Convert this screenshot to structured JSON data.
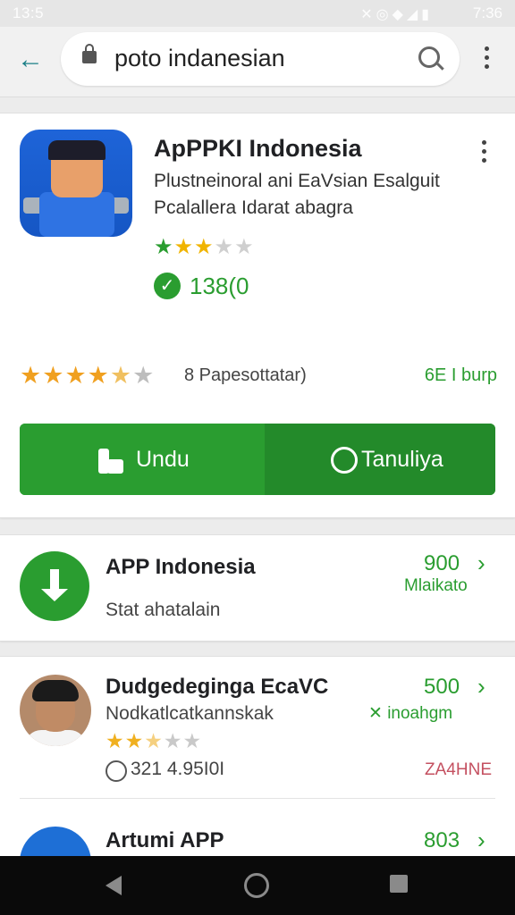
{
  "status_bar": {
    "time_left": "13:5",
    "icons": [
      "mute-icon",
      "alarm-icon",
      "wifi-icon",
      "signal-icon",
      "battery-icon"
    ],
    "time_right": "7:36"
  },
  "search": {
    "query": "poto indanesian"
  },
  "app": {
    "title": "ApPPKI Indonesia",
    "subtitle_line1": "Plustneinoral ani EaVsian Esalguit",
    "subtitle_line2": "Pcalallera Idarat abagra",
    "small_rating_stars": 3,
    "badge_count": "138(0",
    "rating_stars": 5,
    "rating_text": "8 Papesottatar)",
    "size_text": "6E I burp",
    "download_label": "Undu",
    "secondary_label": "Tanuliya"
  },
  "list": [
    {
      "title": "APP Indonesia",
      "subtitle": "Stat ahatalain",
      "number": "900",
      "green_label": "Mlaikato"
    },
    {
      "title": "Dudgedeginga EcaVC",
      "subtitle": "Nodkatlcatkannskak",
      "number": "500",
      "green_label": "inoahgm",
      "stars": 3,
      "info_text": "321 4.95I0I",
      "red_tag": "ZA4HNE"
    },
    {
      "title": "Artumi  APP",
      "number": "803"
    }
  ],
  "colors": {
    "accent_green": "#2a9d30",
    "star_orange": "#f0a020",
    "back_arrow": "#1a7f86",
    "red_tag": "#c45060"
  }
}
